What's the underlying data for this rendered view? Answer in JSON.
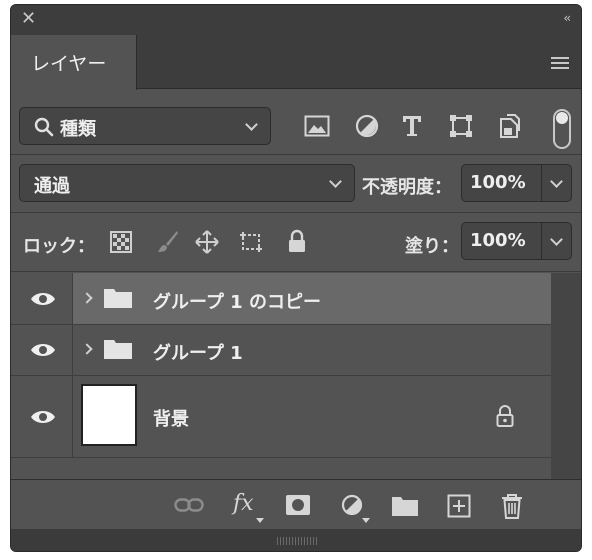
{
  "panel": {
    "tab_label": "レイヤー",
    "close_glyph": "✕",
    "collapse_glyph": "‹‹"
  },
  "filter": {
    "kind_label": "種類",
    "icons": [
      "image-filter-icon",
      "adjustment-filter-icon",
      "type-filter-icon",
      "shape-filter-icon",
      "smart-object-filter-icon"
    ]
  },
  "blend": {
    "mode": "通過",
    "opacity_label": "不透明度：",
    "opacity_value": "100%"
  },
  "lock": {
    "label": "ロック：",
    "fill_label": "塗り：",
    "fill_value": "100%"
  },
  "layers": [
    {
      "name": "グループ 1 のコピー",
      "type": "group",
      "visible": true,
      "selected": true
    },
    {
      "name": "グループ 1",
      "type": "group",
      "visible": true,
      "selected": false
    },
    {
      "name": "背景",
      "type": "background",
      "visible": true,
      "selected": false,
      "locked": true
    }
  ],
  "footer": {
    "fx_label": "fx",
    "icons": [
      "link-layers-icon",
      "fx-icon",
      "add-mask-icon",
      "adjustment-layer-icon",
      "new-group-icon",
      "new-layer-icon",
      "delete-layer-icon"
    ]
  },
  "colors": {
    "panel_bg": "#535353",
    "header_bg": "#3d3d3d",
    "selected_row": "#696969",
    "field_bg": "#454545"
  }
}
